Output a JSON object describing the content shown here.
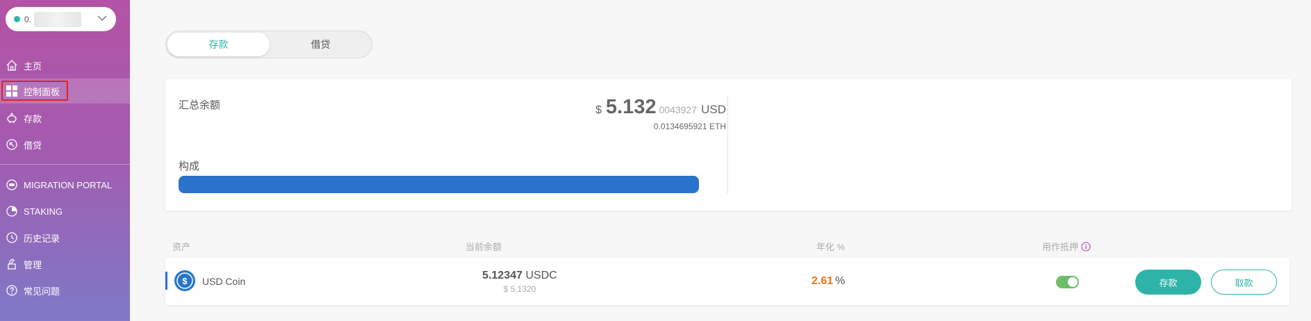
{
  "wallet": {
    "address_prefix": "0."
  },
  "sidebar": {
    "items": [
      {
        "label": "主页",
        "icon": "home-icon"
      },
      {
        "label": "控制面板",
        "icon": "dashboard-icon"
      },
      {
        "label": "存款",
        "icon": "piggy-bank-icon"
      },
      {
        "label": "借贷",
        "icon": "borrow-icon"
      },
      {
        "label": "MIGRATION PORTAL",
        "icon": "migration-icon"
      },
      {
        "label": "STAKING",
        "icon": "staking-icon"
      },
      {
        "label": "历史记录",
        "icon": "history-icon"
      },
      {
        "label": "管理",
        "icon": "manage-icon"
      },
      {
        "label": "常见问题",
        "icon": "question-icon"
      }
    ],
    "active_item": "控制面板"
  },
  "tabs": {
    "deposit": "存款",
    "borrow": "借贷",
    "active": "存款"
  },
  "summary": {
    "total_label": "汇总余额",
    "currency_symbol": "$",
    "amount_main": "5.132",
    "amount_decimals": "0043927",
    "amount_unit": "USD",
    "eth_value": "0.0134695921 ETH",
    "composition_label": "构成",
    "composition": [
      {
        "asset": "USD Coin",
        "share": 1.0
      }
    ]
  },
  "table": {
    "headers": {
      "asset": "资产",
      "balance": "当前余额",
      "apy": "年化 %",
      "collateral": "用作抵押"
    },
    "rows": [
      {
        "asset": "USD Coin",
        "balance_amount": "5.12347",
        "balance_unit": "USDC",
        "balance_usd": "$ 5.1320",
        "apy_value": "2.61",
        "apy_unit": "%",
        "collateral_enabled": true,
        "deposit_label": "存款",
        "withdraw_label": "取款"
      }
    ]
  },
  "colors": {
    "accent": "#2eb3a9",
    "apy": "#f07417",
    "bar": "#2973cc",
    "sidebar_top": "#b353a6",
    "sidebar_bottom": "#7f79c7",
    "highlight": "#e0231f"
  }
}
